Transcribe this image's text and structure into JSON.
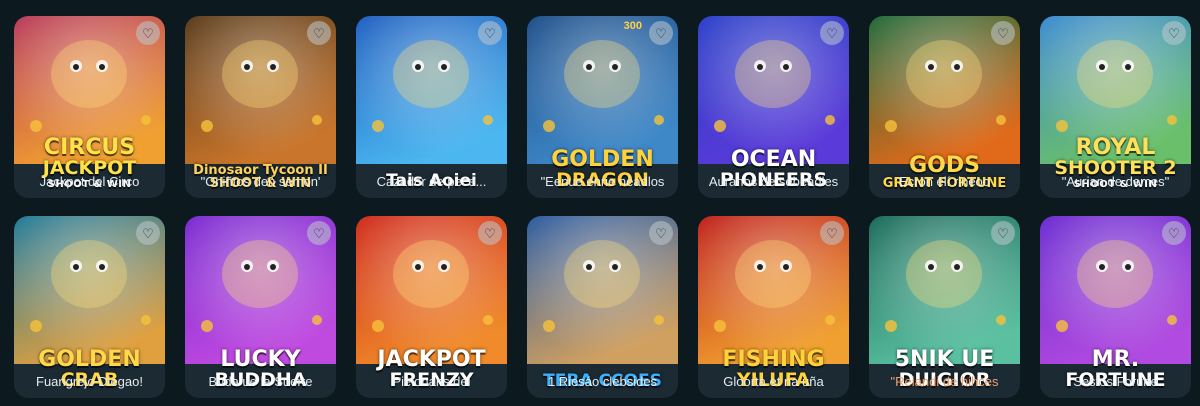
{
  "colors": {
    "background": "#0c1a1f",
    "card": "#1b2a33",
    "highlight_caption": "#f0a06a"
  },
  "favorite_icon": "heart-icon",
  "games": [
    {
      "id": "circus",
      "caption": "Jackpot del Circo",
      "logo": [
        "CIRCUS",
        "JACKPOT",
        "SHOOT & WIN"
      ],
      "bg": [
        "#b93a5a",
        "#f0a030"
      ],
      "logo_color": "#ffe24a"
    },
    {
      "id": "dino",
      "caption": "\"Oniñtos den semon'",
      "logo": [
        "Dinosaor Tycoon II",
        "SHOOT & WIN",
        ""
      ],
      "bg": [
        "#5a3b1a",
        "#c9752b"
      ],
      "logo_color": "#ffd25a"
    },
    {
      "id": "shark",
      "caption": "Cazador de pece...",
      "logo": [
        "Tais Aoiei",
        "",
        ""
      ],
      "bg": [
        "#1e5fc0",
        "#4bb6f0"
      ],
      "logo_color": "#ffffff"
    },
    {
      "id": "dragon",
      "caption": "\"Eenue enrie nėadlos",
      "logo": [
        "GOLDEN",
        "DRAGON",
        ""
      ],
      "bg": [
        "#1d4e8a",
        "#3e88c8"
      ],
      "logo_color": "#ffd23a",
      "mark": "300"
    },
    {
      "id": "ocean",
      "caption": "Auranos de sebeadles",
      "logo": [
        "OCEAN",
        "PIONEERS",
        ""
      ],
      "bg": [
        "#2a3fc8",
        "#5a3ad8"
      ],
      "logo_color": "#ffffff"
    },
    {
      "id": "gods",
      "caption": "Ecron elí rineoo",
      "logo": [
        "GODS",
        "GRANT FORTUNE",
        ""
      ],
      "bg": [
        "#1f6a3a",
        "#e06a1a"
      ],
      "logo_color": "#ffd84a"
    },
    {
      "id": "royal",
      "caption": "\"Aurian de demes\"",
      "logo": [
        "ROYAL",
        "SHOOTER 2",
        "SHOOT & WIN"
      ],
      "bg": [
        "#3a8ad0",
        "#6ac06a"
      ],
      "logo_color": "#ffe05a"
    },
    {
      "id": "crab",
      "caption": "Fuangrejo Diegao!",
      "logo": [
        "GOLDEN",
        "CRAB",
        ""
      ],
      "bg": [
        "#1f7a9a",
        "#e0a040"
      ],
      "logo_color": "#ffd84a"
    },
    {
      "id": "buddha",
      "caption": "Buda ue la Suerte",
      "logo": [
        "LUCKY",
        "BUDDHA",
        ""
      ],
      "bg": [
        "#7a2ad0",
        "#c04ae0"
      ],
      "logo_color": "#ffffff"
    },
    {
      "id": "frenzy",
      "caption": "Pielonans del",
      "logo": [
        "JACKPOT",
        "FRENZY",
        ""
      ],
      "bg": [
        "#d02a1a",
        "#f08a2a"
      ],
      "logo_color": "#ffffff"
    },
    {
      "id": "tera",
      "caption": "1 Riesáo clebsides",
      "logo": [
        "TERA CCOES",
        "",
        ""
      ],
      "bg": [
        "#2a5aa0",
        "#d0a060"
      ],
      "logo_color": "#3ab0ff"
    },
    {
      "id": "fishing",
      "caption": "Gloorta et na uña",
      "logo": [
        "FISHING",
        "YILUFA",
        ""
      ],
      "bg": [
        "#c0201a",
        "#f0a030"
      ],
      "logo_color": "#ffd23a"
    },
    {
      "id": "snike",
      "caption": "\"Reiandi de hihces",
      "logo": [
        "5NIK UE",
        "DUIGIOR",
        ""
      ],
      "bg": [
        "#1a6a5a",
        "#5ac0a0"
      ],
      "logo_color": "#ffffff",
      "highlight": true
    },
    {
      "id": "mrfortune",
      "caption": "Sestos Forurle",
      "logo": [
        "MR.",
        "FORTUNE",
        ""
      ],
      "bg": [
        "#6a2ad0",
        "#b04ae0"
      ],
      "logo_color": "#ffffff"
    }
  ]
}
